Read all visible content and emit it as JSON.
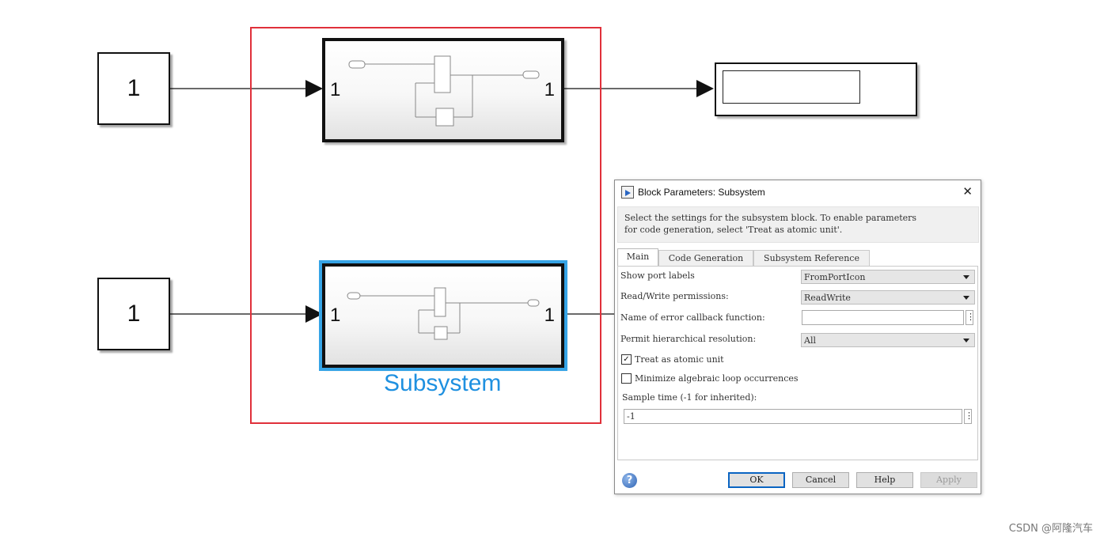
{
  "canvas": {
    "const_top_value": "1",
    "const_bottom_value": "1",
    "sub_top_in_port": "1",
    "sub_top_out_port": "1",
    "sub_bottom_in_port": "1",
    "sub_bottom_out_port": "1",
    "subsystem_label": "Subsystem",
    "colors": {
      "selection_frame": "#e0303a",
      "selected_outline": "#36a4e6",
      "label": "#1e90e0"
    }
  },
  "dialog": {
    "title": "Block Parameters: Subsystem",
    "description_line1": "Select the settings for the subsystem block. To enable parameters",
    "description_line2": "for code generation, select 'Treat as atomic unit'.",
    "tabs": [
      {
        "label": "Main",
        "active": true
      },
      {
        "label": "Code Generation",
        "active": false
      },
      {
        "label": "Subsystem Reference",
        "active": false
      }
    ],
    "fields": {
      "show_port_labels": {
        "label": "Show port labels",
        "value": "FromPortIcon"
      },
      "read_write": {
        "label": "Read/Write permissions:",
        "value": "ReadWrite"
      },
      "error_callback": {
        "label": "Name of error callback function:",
        "value": ""
      },
      "hier_resolution": {
        "label": "Permit hierarchical resolution:",
        "value": "All"
      },
      "atomic": {
        "label": "Treat as atomic unit",
        "checked": true,
        "mark": "✓"
      },
      "min_alg_loop": {
        "label": "Minimize algebraic loop occurrences",
        "checked": false,
        "mark": ""
      },
      "sample_time": {
        "label": "Sample time (-1 for inherited):",
        "value": "-1"
      }
    },
    "buttons": {
      "ok": "OK",
      "cancel": "Cancel",
      "help": "Help",
      "apply": "Apply"
    },
    "icons": {
      "close": "✕",
      "help": "?",
      "more": "⋮"
    }
  },
  "watermark": "CSDN @阿隆汽车"
}
